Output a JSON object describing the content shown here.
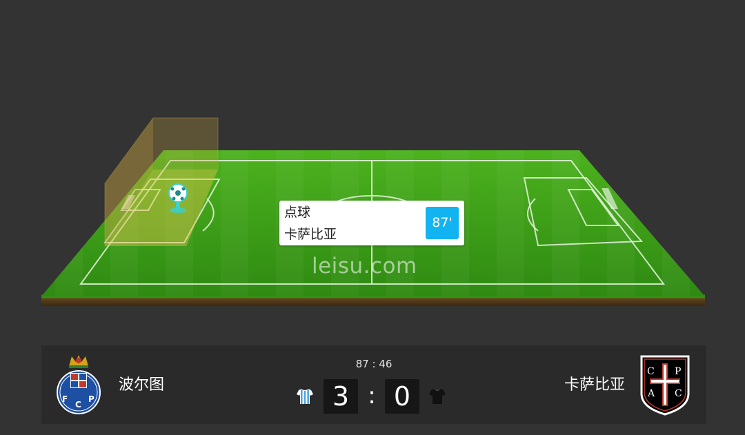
{
  "event": {
    "type": "点球",
    "team": "卡萨比亚",
    "minute": "87'"
  },
  "watermark": "leisu.com",
  "match": {
    "clock": "87 : 46",
    "home": {
      "name": "波尔图",
      "score": "3",
      "badge_letters": "FCP",
      "kit_color": "#4aa3e0"
    },
    "away": {
      "name": "卡萨比亚",
      "score": "0",
      "badge_letters": [
        "C",
        "P",
        "A",
        "C"
      ],
      "kit_color": "#111111"
    },
    "separator": ":"
  },
  "icons": {
    "ball_marker": "penalty-ball-icon",
    "goal_left": "goal-net-icon",
    "goal_right": "goal-net-icon"
  },
  "colors": {
    "background": "#333333",
    "pitch": "#3fa018",
    "highlight_zone": "#c9a640",
    "minute_badge": "#11b4f0",
    "scorebar": "#2a2a2a"
  }
}
